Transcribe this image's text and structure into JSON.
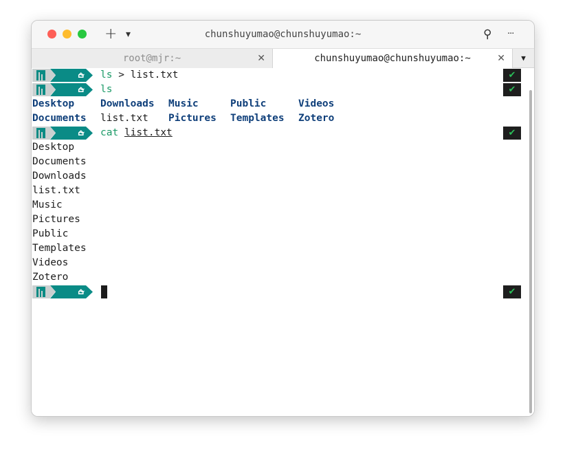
{
  "window": {
    "title": "chunshuyumao@chunshuyumao:~",
    "new_tab_glyph": "+",
    "dropdown_glyph": "▾",
    "search_glyph": "⚲",
    "more_glyph": "···"
  },
  "tabs": [
    {
      "label": "root@mjr:~",
      "close": "✕",
      "active": false
    },
    {
      "label": "chunshuyumao@chunshuyumao:~",
      "close": "✕",
      "active": true
    }
  ],
  "tab_menu_glyph": "▼",
  "prompt": {
    "dir": "~",
    "home_glyph": "⌂",
    "status_glyph": "✔"
  },
  "commands": [
    {
      "cmd": "ls",
      "rest": " > list.txt"
    },
    {
      "cmd": "ls",
      "rest": ""
    },
    {
      "cmd": "cat",
      "rest": " ",
      "arg": "list.txt"
    }
  ],
  "ls_output": [
    [
      "Desktop",
      "Downloads",
      "Music",
      "Public",
      "Videos"
    ],
    [
      "Documents",
      "list.txt",
      "Pictures",
      "Templates",
      "Zotero"
    ]
  ],
  "cat_output": [
    "Desktop",
    "Documents",
    "Downloads",
    "list.txt",
    "Music",
    "Pictures",
    "Public",
    "Templates",
    "Videos",
    "Zotero"
  ],
  "colors": {
    "prompt_teal": "#0a8b86",
    "directory_blue": "#0f3f7a",
    "command_green": "#1b9a67",
    "check_green": "#2bc05a"
  }
}
